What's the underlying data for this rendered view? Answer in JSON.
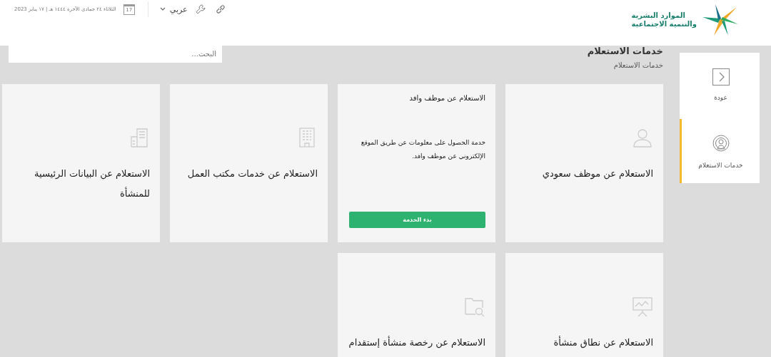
{
  "header": {
    "date": "الثلاثاء ٢٤ جمادى الآخرة ١٤٤٤ هـ | ١٧ يناير 2023",
    "calendar_day": "17",
    "language": "عربي",
    "logo_lines": [
      "الموارد البشرية",
      "والتنمية الاجتماعية"
    ]
  },
  "sidebar": {
    "items": [
      {
        "label": "عودة",
        "kind": "back",
        "selected": false
      },
      {
        "label": "خدمات الاستعلام",
        "kind": "services",
        "selected": true
      }
    ]
  },
  "page": {
    "title": "خدمات الاستعلام",
    "breadcrumb": "خدمات الاستعلام",
    "search": {
      "placeholder": "البحث..."
    }
  },
  "cards": [
    {
      "kind": "tile",
      "title": "الاستعلام عن موظف سعودي"
    },
    {
      "kind": "detail",
      "title": "الاستعلام عن موظف وافد",
      "description": "خدمة الحصول على معلومات عن طريق الموقع الإلكتروني عن موظف وافد.",
      "button": "بدء الخدمة"
    },
    {
      "kind": "tile",
      "title": "الاستعلام عن خدمات مكتب العمل"
    },
    {
      "kind": "tile",
      "title": "الاستعلام عن البيانات الرئيسية للمنشأة"
    },
    {
      "kind": "tile",
      "title": "الاستعلام عن نطاق منشأة"
    },
    {
      "kind": "tile",
      "title": "الاستعلام عن رخصة منشأة إستقدام"
    }
  ]
}
